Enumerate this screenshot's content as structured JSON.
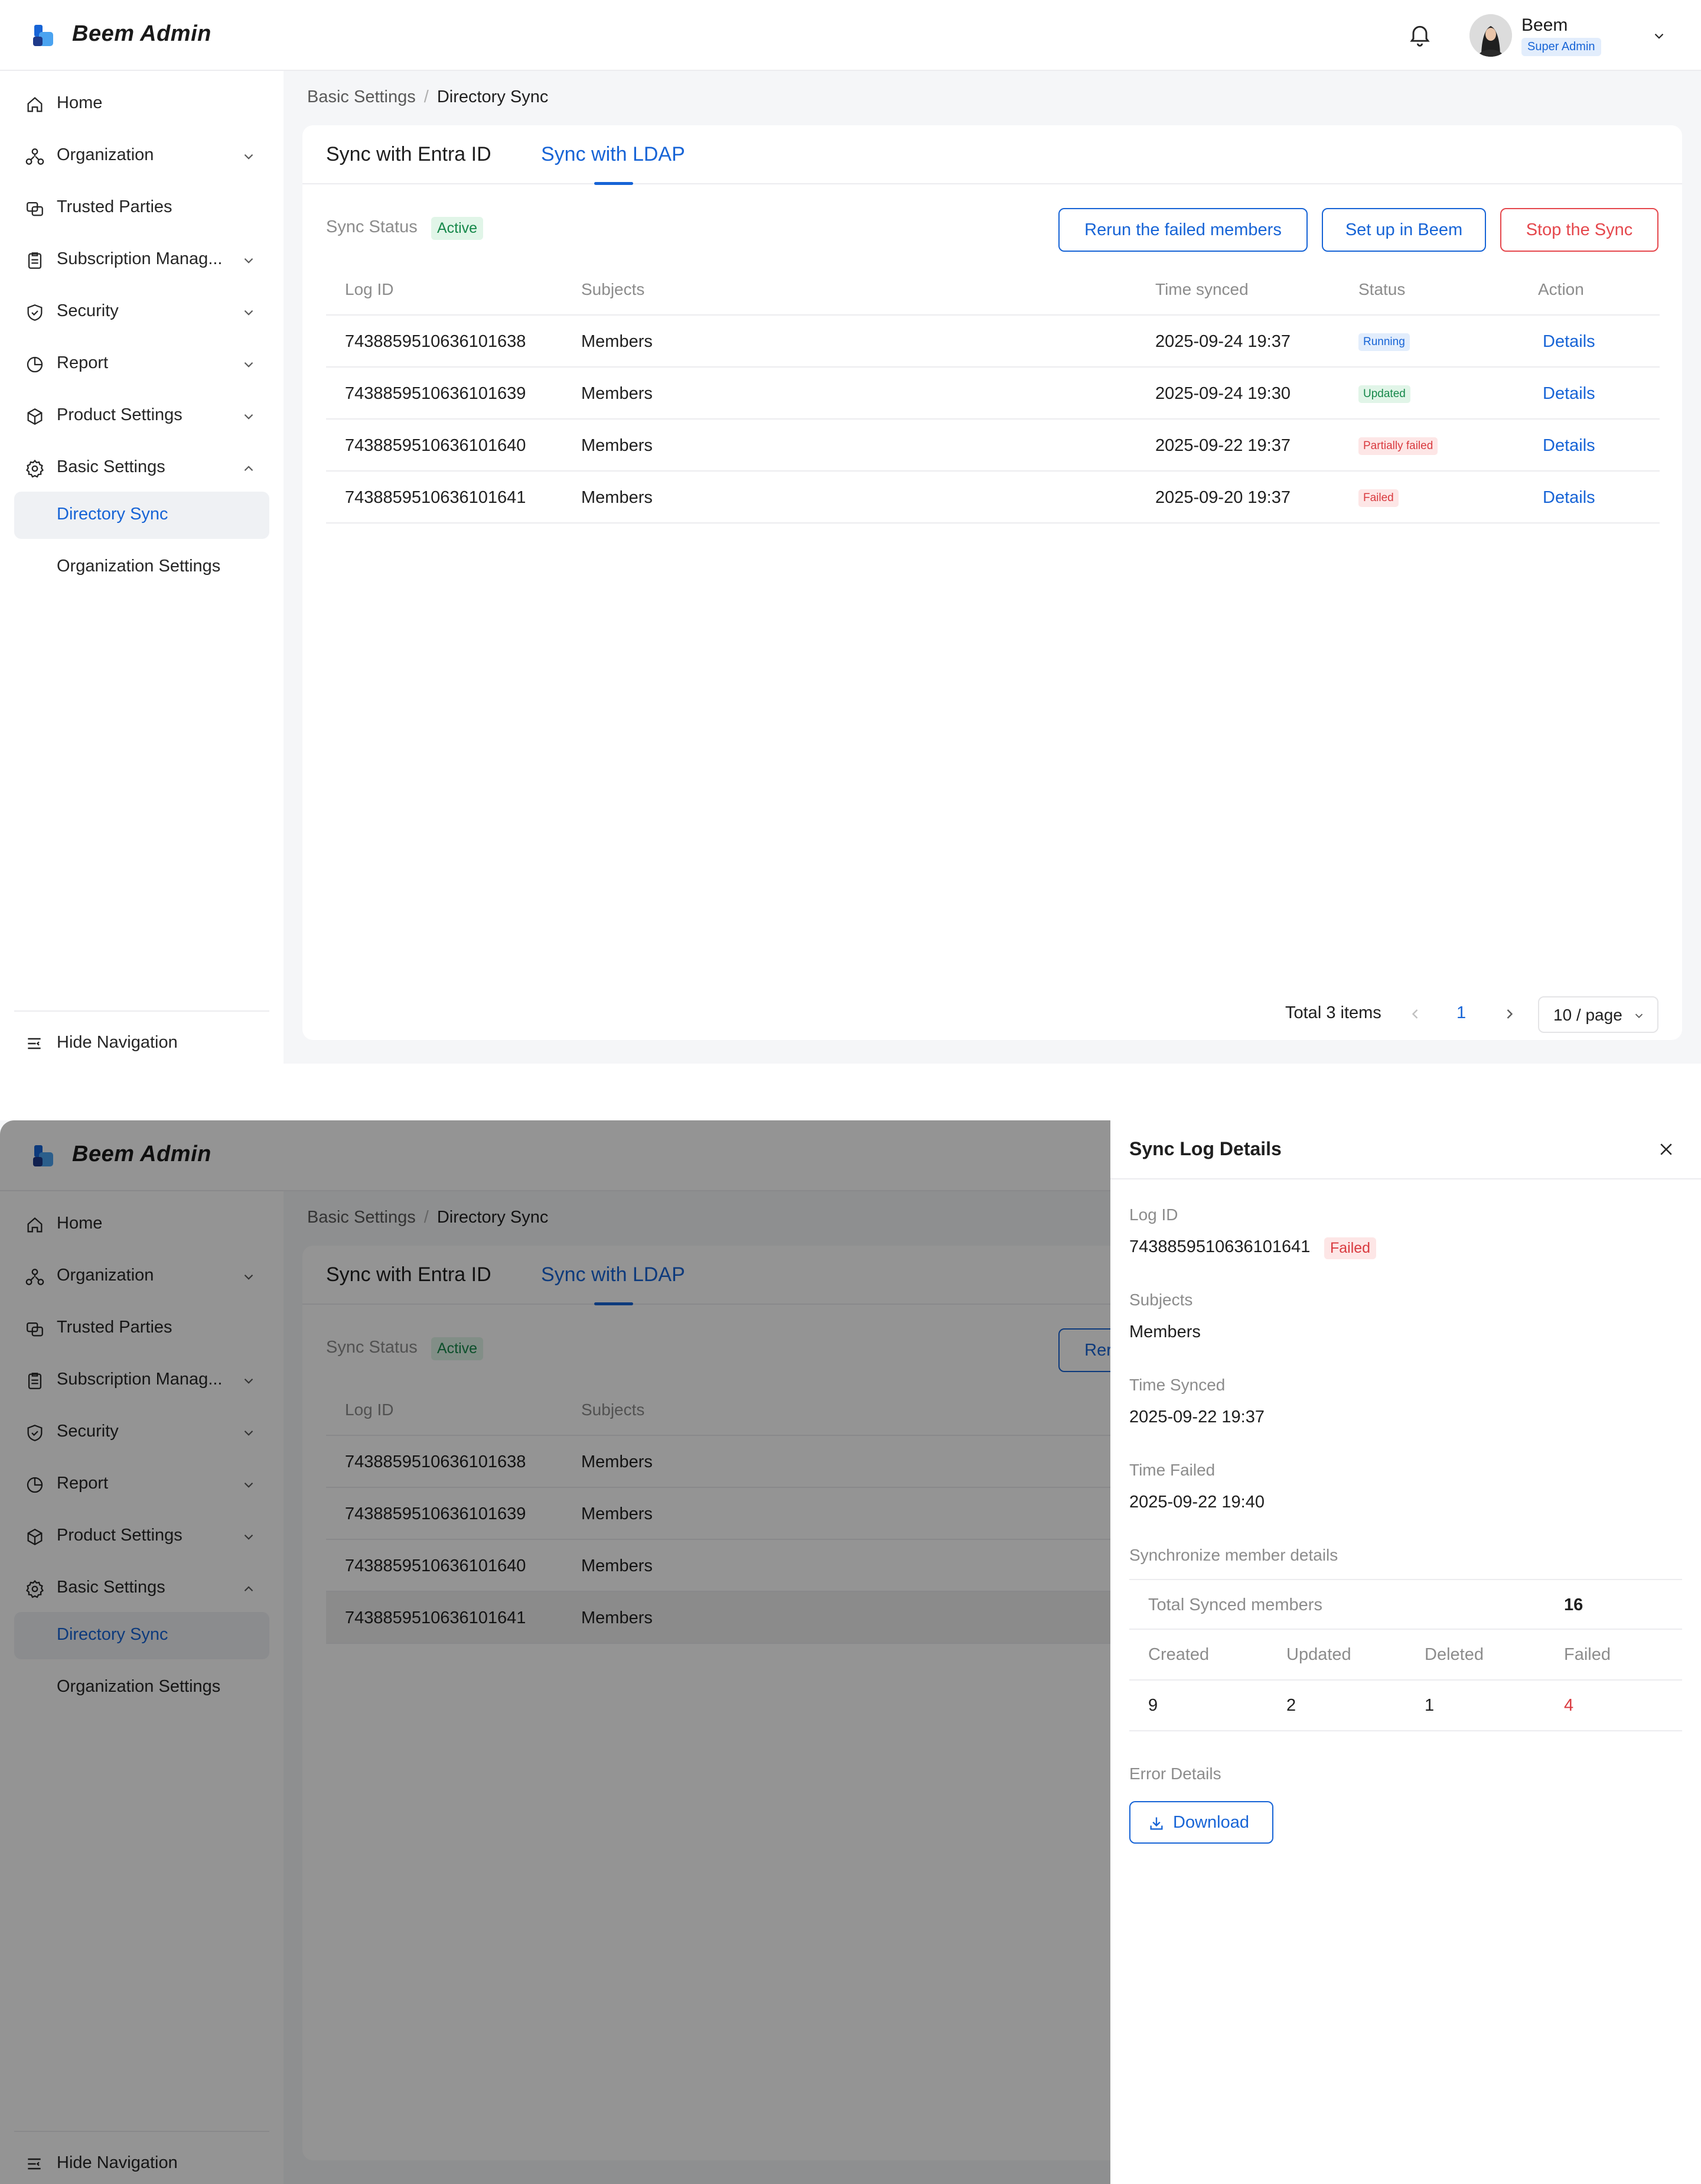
{
  "app": {
    "brand": "Beem Admin"
  },
  "user": {
    "name": "Beem",
    "role": "Super Admin"
  },
  "sidebar": {
    "items": [
      {
        "label": "Home",
        "icon": "home-icon"
      },
      {
        "label": "Organization",
        "icon": "organization-icon"
      },
      {
        "label": "Trusted Parties",
        "icon": "trusted-parties-icon"
      },
      {
        "label": "Subscription Manag...",
        "icon": "clipboard-icon"
      },
      {
        "label": "Security",
        "icon": "shield-icon"
      },
      {
        "label": "Report",
        "icon": "pie-chart-icon"
      },
      {
        "label": "Product Settings",
        "icon": "box-icon"
      },
      {
        "label": "Basic Settings",
        "icon": "gear-icon"
      }
    ],
    "sub_items": [
      {
        "label": "Directory Sync"
      },
      {
        "label": "Organization Settings"
      }
    ],
    "hide_navigation": "Hide Navigation"
  },
  "breadcrumb": {
    "parent": "Basic Settings",
    "separator": "/",
    "current": "Directory Sync"
  },
  "tabs": [
    {
      "label": "Sync with Entra ID"
    },
    {
      "label": "Sync with LDAP"
    }
  ],
  "sync_status": {
    "label": "Sync Status",
    "value": "Active"
  },
  "actions": {
    "rerun": "Rerun the failed members",
    "setup": "Set up in Beem",
    "stop": "Stop the Sync"
  },
  "table": {
    "columns": [
      "Log ID",
      "Subjects",
      "Time synced",
      "Status",
      "Action"
    ],
    "rows": [
      {
        "log_id": "7438859510636101638",
        "subjects": "Members",
        "time": "2025-09-24 19:37",
        "status": "Running",
        "action": "Details"
      },
      {
        "log_id": "7438859510636101639",
        "subjects": "Members",
        "time": "2025-09-24 19:30",
        "status": "Updated",
        "action": "Details"
      },
      {
        "log_id": "7438859510636101640",
        "subjects": "Members",
        "time": "2025-09-22 19:37",
        "status": "Partially failed",
        "action": "Details"
      },
      {
        "log_id": "7438859510636101641",
        "subjects": "Members",
        "time": "2025-09-20 19:37",
        "status": "Failed",
        "action": "Details"
      }
    ]
  },
  "pagination": {
    "total": "Total 3 items",
    "page": "1",
    "page_size": "10 / page"
  },
  "drawer": {
    "title": "Sync Log Details",
    "log_id_label": "Log ID",
    "log_id": "7438859510636101641",
    "status": "Failed",
    "subjects_label": "Subjects",
    "subjects": "Members",
    "time_synced_label": "Time Synced",
    "time_synced": "2025-09-22 19:37",
    "time_failed_label": "Time Failed",
    "time_failed": "2025-09-22 19:40",
    "member_details_label": "Synchronize member details",
    "total_synced_label": "Total Synced members",
    "total_synced": "16",
    "stat_headers": [
      "Created",
      "Updated",
      "Deleted",
      "Failed"
    ],
    "stat_values": [
      "9",
      "2",
      "1",
      "4"
    ],
    "error_details_label": "Error Details",
    "download": "Download"
  },
  "colors": {
    "accent": "#1764d6",
    "danger": "#e5484d",
    "success": "#16884a"
  }
}
